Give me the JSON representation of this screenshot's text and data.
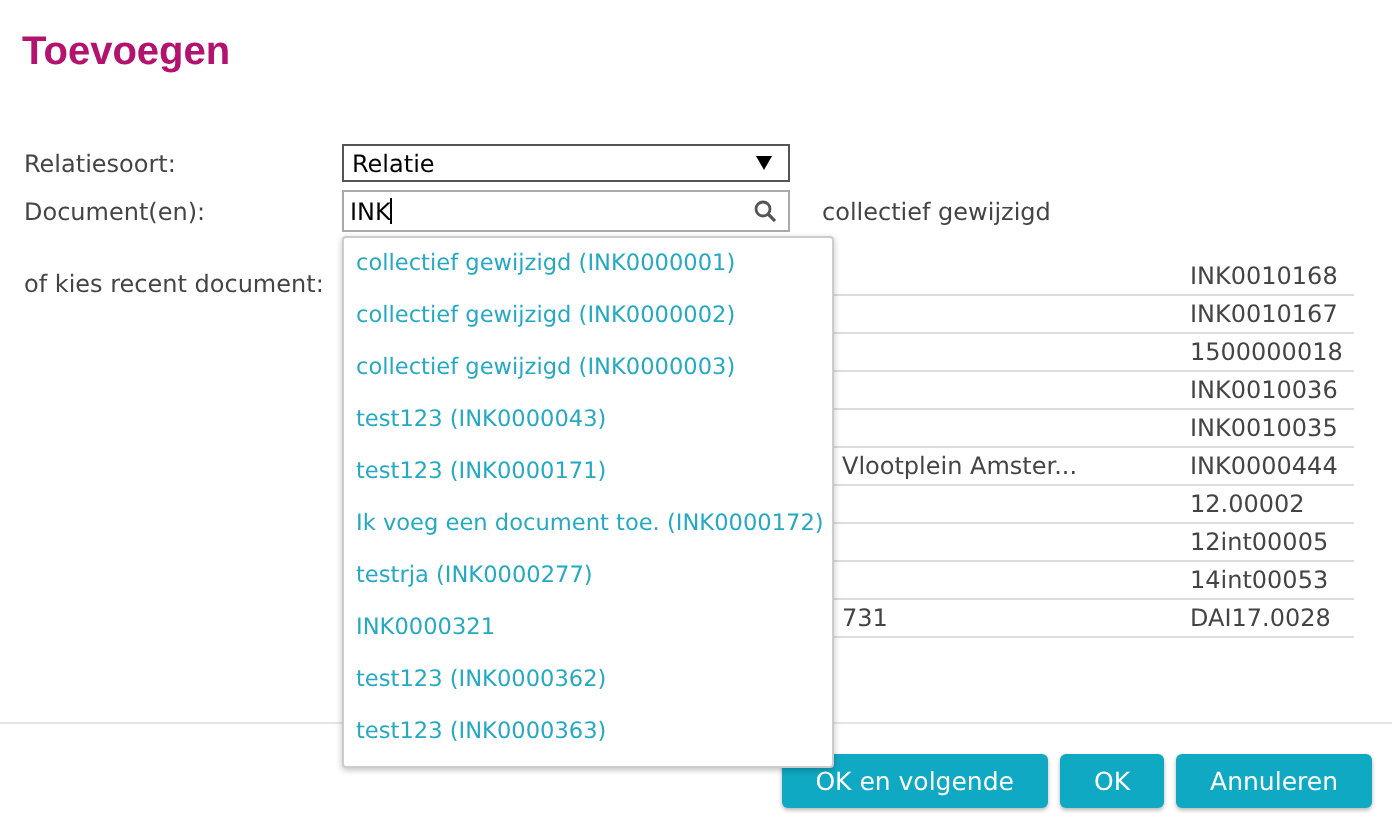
{
  "title": "Toevoegen",
  "form": {
    "relation_label": "Relatiesoort:",
    "relation_value": "Relatie",
    "documents_label": "Document(en):",
    "documents_value": "INK",
    "selected_document": "collectief gewijzigd",
    "recent_label": "of kies recent document:"
  },
  "suggestions": [
    "collectief gewijzigd (INK0000001)",
    "collectief gewijzigd (INK0000002)",
    "collectief gewijzigd (INK0000003)",
    "test123 (INK0000043)",
    "test123 (INK0000171)",
    "Ik voeg een document toe. (INK0000172)",
    "testrja (INK0000277)",
    "INK0000321",
    "test123 (INK0000362)",
    "test123 (INK0000363)"
  ],
  "recent_rows": [
    {
      "column_2": "",
      "column_3": "INK0010168"
    },
    {
      "column_2": "",
      "column_3": "INK0010167"
    },
    {
      "column_2": "",
      "column_3": "1500000018"
    },
    {
      "column_2": "",
      "column_3": "INK0010036"
    },
    {
      "column_2": "",
      "column_3": "INK0010035"
    },
    {
      "column_2": "Vlootplein Amster...",
      "column_3": "INK0000444"
    },
    {
      "column_2": "",
      "column_3": "12.00002"
    },
    {
      "column_2": "",
      "column_3": "12int00005"
    },
    {
      "column_2": "",
      "column_3": "14int00053"
    },
    {
      "column_2": "731",
      "column_3": "DAI17.0028"
    }
  ],
  "buttons": [
    "OK en volgende",
    "OK",
    "Annuleren"
  ]
}
